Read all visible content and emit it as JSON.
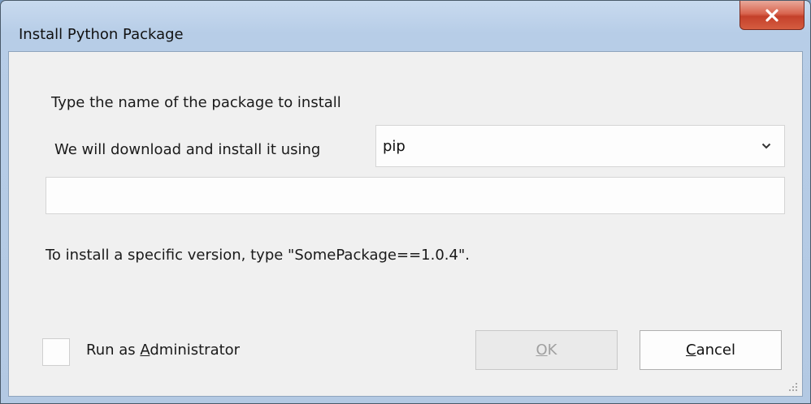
{
  "window": {
    "title": "Install Python Package",
    "close_glyph": "x"
  },
  "form": {
    "instruction": "Type the name of the package to install",
    "download_label": "We will download and install it using",
    "installer_selected": "pip",
    "package_input_value": "",
    "package_input_placeholder": "",
    "hint": "To install a specific version, type \"SomePackage==1.0.4\"."
  },
  "options": {
    "run_as_admin_checked": false,
    "run_as_admin_pre": "Run as ",
    "run_as_admin_accel": "A",
    "run_as_admin_post": "dministrator"
  },
  "buttons": {
    "ok_accel": "O",
    "ok_rest": "K",
    "ok_enabled": false,
    "cancel_accel": "C",
    "cancel_rest": "ancel"
  },
  "colors": {
    "close_button": "#c4402a",
    "dialog_background": "#f0f0f0",
    "frame": "#b7cde7"
  },
  "icons": [
    "close-icon",
    "chevron-down-icon",
    "resize-grip-icon"
  ]
}
